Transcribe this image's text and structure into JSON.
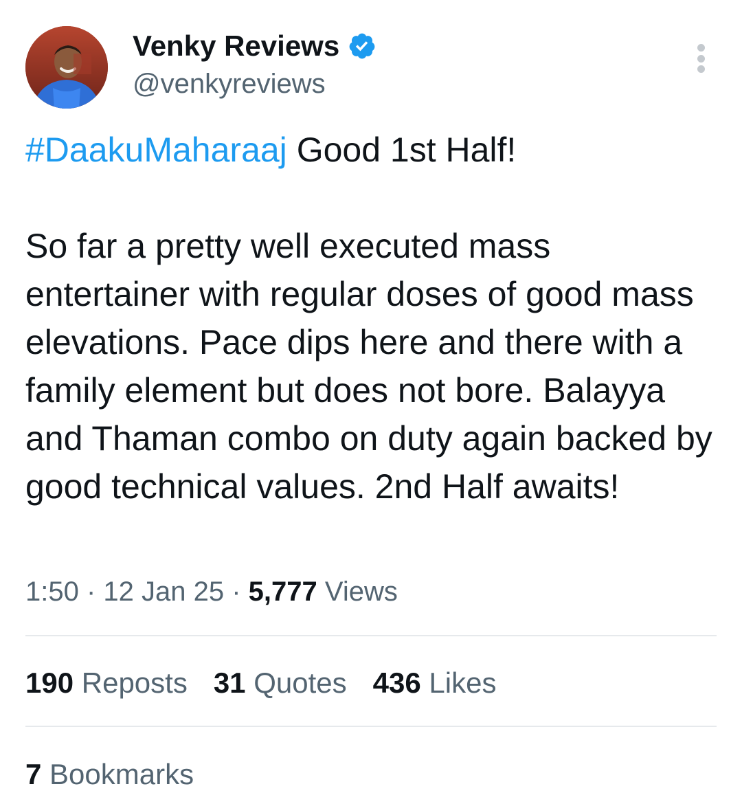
{
  "author": {
    "display_name": "Venky Reviews",
    "handle": "@venkyreviews",
    "verified": true,
    "verified_color": "#1d9bf0"
  },
  "tweet": {
    "hashtag": "#DaakuMaharaaj",
    "headline_rest": " Good 1st Half!",
    "body": "So far a pretty well executed mass entertainer with regular doses of good mass elevations. Pace dips here and there with a family element but does not bore. Balayya and Thaman combo on duty again backed by good technical values. 2nd Half awaits!"
  },
  "meta": {
    "time": "1:50",
    "separator": " · ",
    "date": "12 Jan 25",
    "views_count": "5,777",
    "views_label": "Views"
  },
  "stats": {
    "reposts_count": "190",
    "reposts_label": "Reposts",
    "quotes_count": "31",
    "quotes_label": "Quotes",
    "likes_count": "436",
    "likes_label": "Likes",
    "bookmarks_count": "7",
    "bookmarks_label": "Bookmarks"
  },
  "icons": {
    "verified": "verified-badge-icon",
    "more": "more-options-icon"
  },
  "colors": {
    "link": "#1d9bf0",
    "secondary_text": "#536471",
    "primary_text": "#0f1419"
  }
}
